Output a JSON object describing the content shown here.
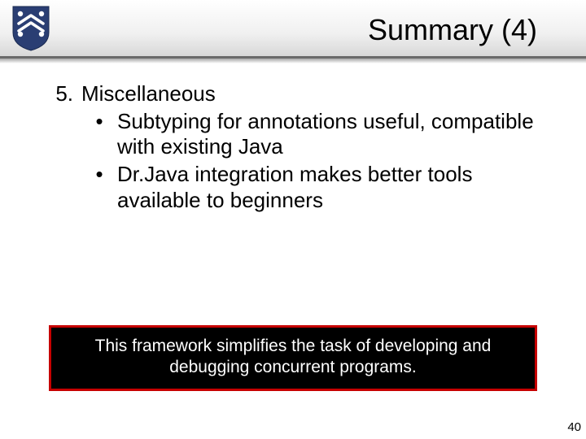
{
  "header": {
    "title": "Summary (4)"
  },
  "content": {
    "item_number": "5.",
    "item_heading": "Miscellaneous",
    "bullets": [
      "Subtyping for annotations useful, compatible with existing Java",
      "Dr.Java integration makes better tools available to beginners"
    ]
  },
  "callout": {
    "text": "This framework simplifies the task of developing and debugging concurrent programs."
  },
  "page_number": "40",
  "logo": {
    "bg": "#2a3e73",
    "fg": "#ffffff"
  }
}
